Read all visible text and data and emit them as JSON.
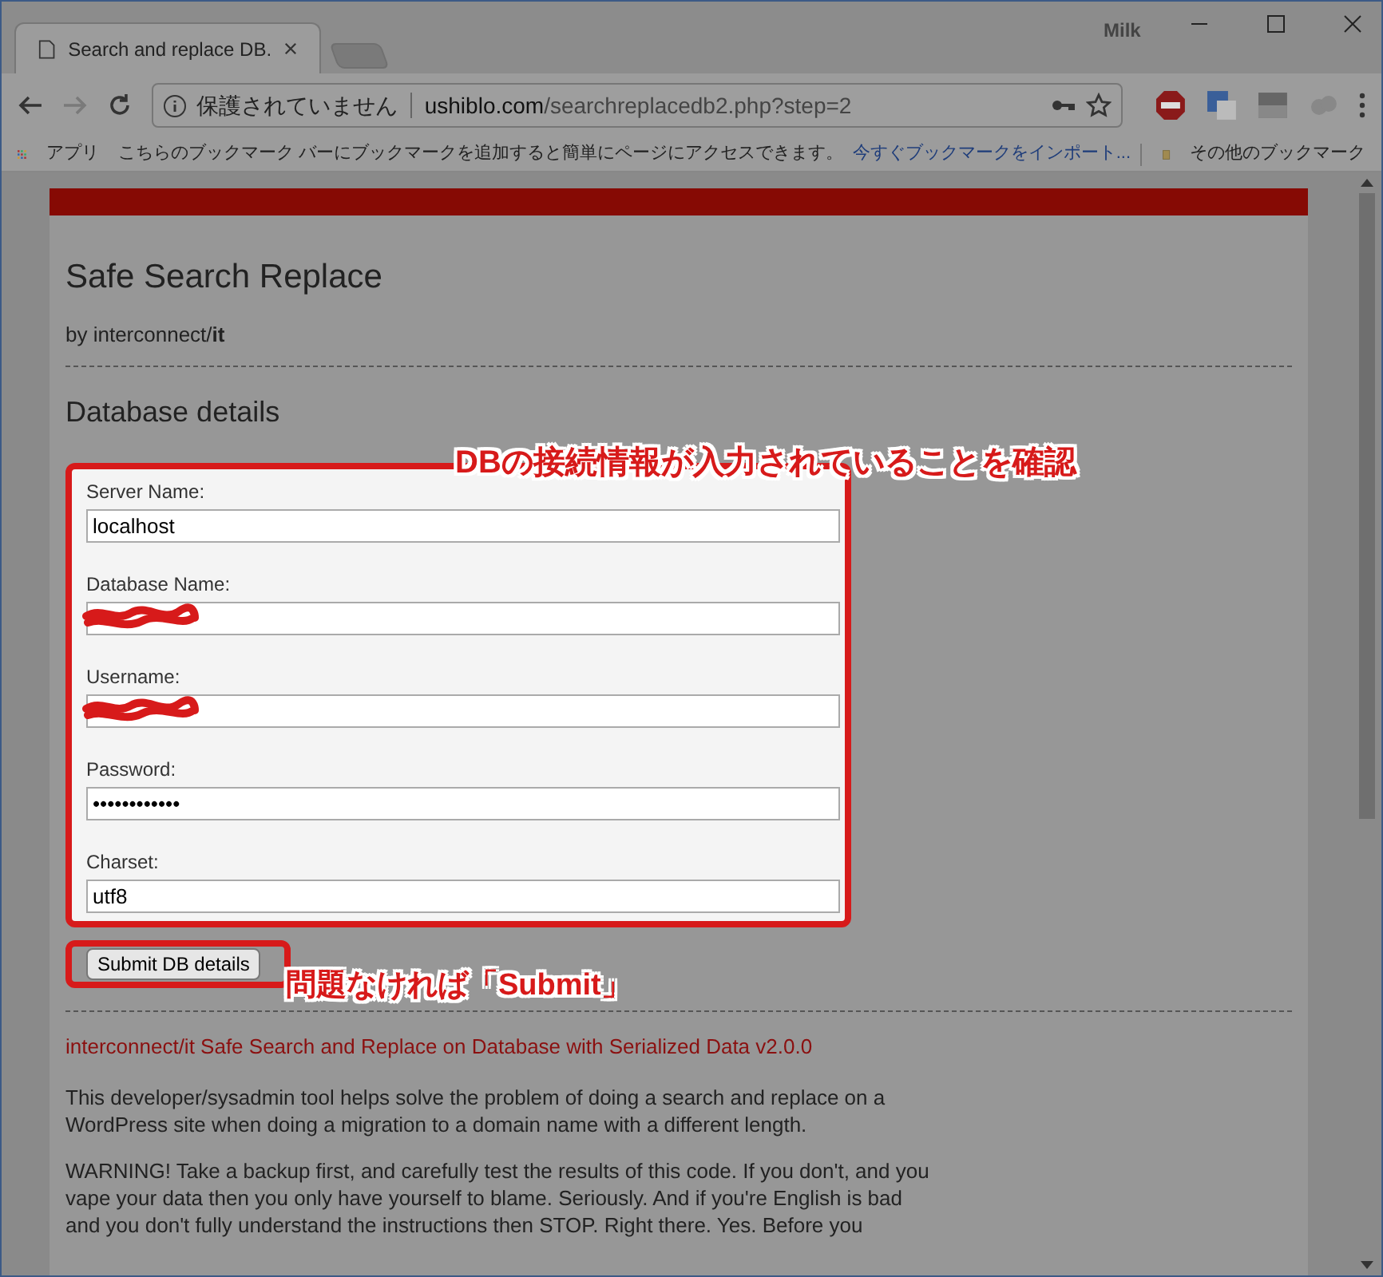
{
  "window": {
    "profile": "Milk"
  },
  "tabs": [
    {
      "kind": "page",
      "title": "Search and replace DB.",
      "selected": true
    },
    {
      "kind": "new",
      "selected": false
    }
  ],
  "address_bar": {
    "security": "保護されていません",
    "domain": "ushiblo.com",
    "path": "/searchreplacedb2.php?step=2"
  },
  "bookmarks_bar": {
    "apps": "アプリ",
    "hint": "こちらのブックマーク バーにブックマークを追加すると簡単にページにアクセスできます。",
    "import_link": "今すぐブックマークをインポート...",
    "other": "その他のブックマーク"
  },
  "page": {
    "title": "Safe Search Replace",
    "byline": "by interconnect/**it**",
    "section": "Database details",
    "fields": [
      {
        "label": "Server Name:",
        "kind": "text",
        "value": "localhost"
      },
      {
        "label": "Database Name:",
        "kind": "redacted"
      },
      {
        "label": "Username:",
        "kind": "redacted"
      },
      {
        "label": "Password:",
        "kind": "text",
        "value": "••••••••••••"
      },
      {
        "label": "Charset:",
        "kind": "text",
        "value": "utf8"
      }
    ],
    "submit": "Submit DB details",
    "credit": "interconnect/it Safe Search and Replace on Database with Serialized Data v2.0.0",
    "paragraphs": [
      "This developer/sysadmin tool helps solve the problem of doing a search and replace on a WordPress site when doing a migration to a domain name with a different length.",
      "WARNING! Take a backup first, and carefully test the results of this code. If you don't, and you vape your data then you only have yourself to blame. Seriously. And if you're English is bad and you don't fully understand the instructions then STOP. Right there. Yes. Before you"
    ]
  },
  "annotations": [
    "DBの接続情報が入力されていることを確認",
    "問題なければ「Submit」"
  ]
}
